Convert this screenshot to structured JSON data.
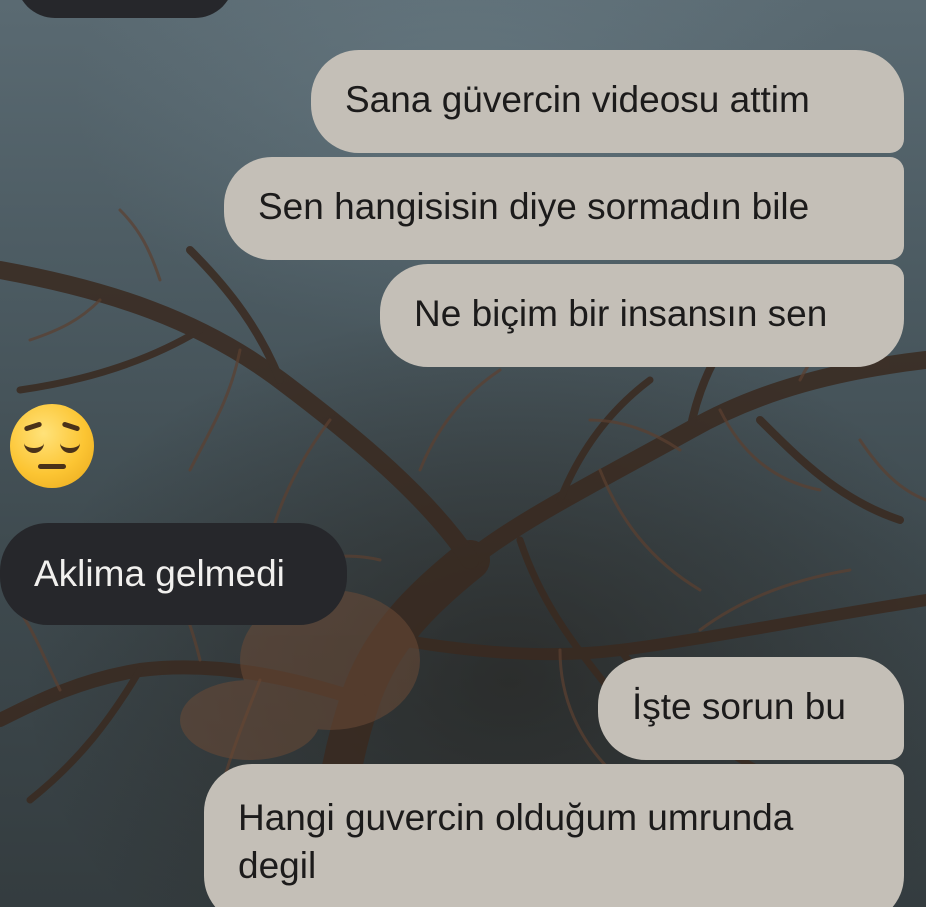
{
  "conversation": {
    "messages": [
      {
        "direction": "incoming",
        "text": ""
      },
      {
        "direction": "outgoing",
        "text": "Sana güvercin videosu attim"
      },
      {
        "direction": "outgoing",
        "text": "Sen hangisisin diye sormadın bile"
      },
      {
        "direction": "outgoing",
        "text": "Ne biçim bir insansın sen"
      },
      {
        "direction": "incoming",
        "type": "emoji",
        "icon": "pensive-face-icon",
        "text": "😔"
      },
      {
        "direction": "incoming",
        "text": "Aklima gelmedi"
      },
      {
        "direction": "outgoing",
        "text": "İşte sorun bu"
      },
      {
        "direction": "outgoing",
        "lines": [
          "Hangi guvercin olduğum umrunda",
          "degil"
        ]
      }
    ]
  },
  "colors": {
    "outgoing_bubble": "#c4bfb7",
    "incoming_bubble": "#26272b",
    "outgoing_text": "#1c1b1b",
    "incoming_text": "#f1f0ee"
  }
}
